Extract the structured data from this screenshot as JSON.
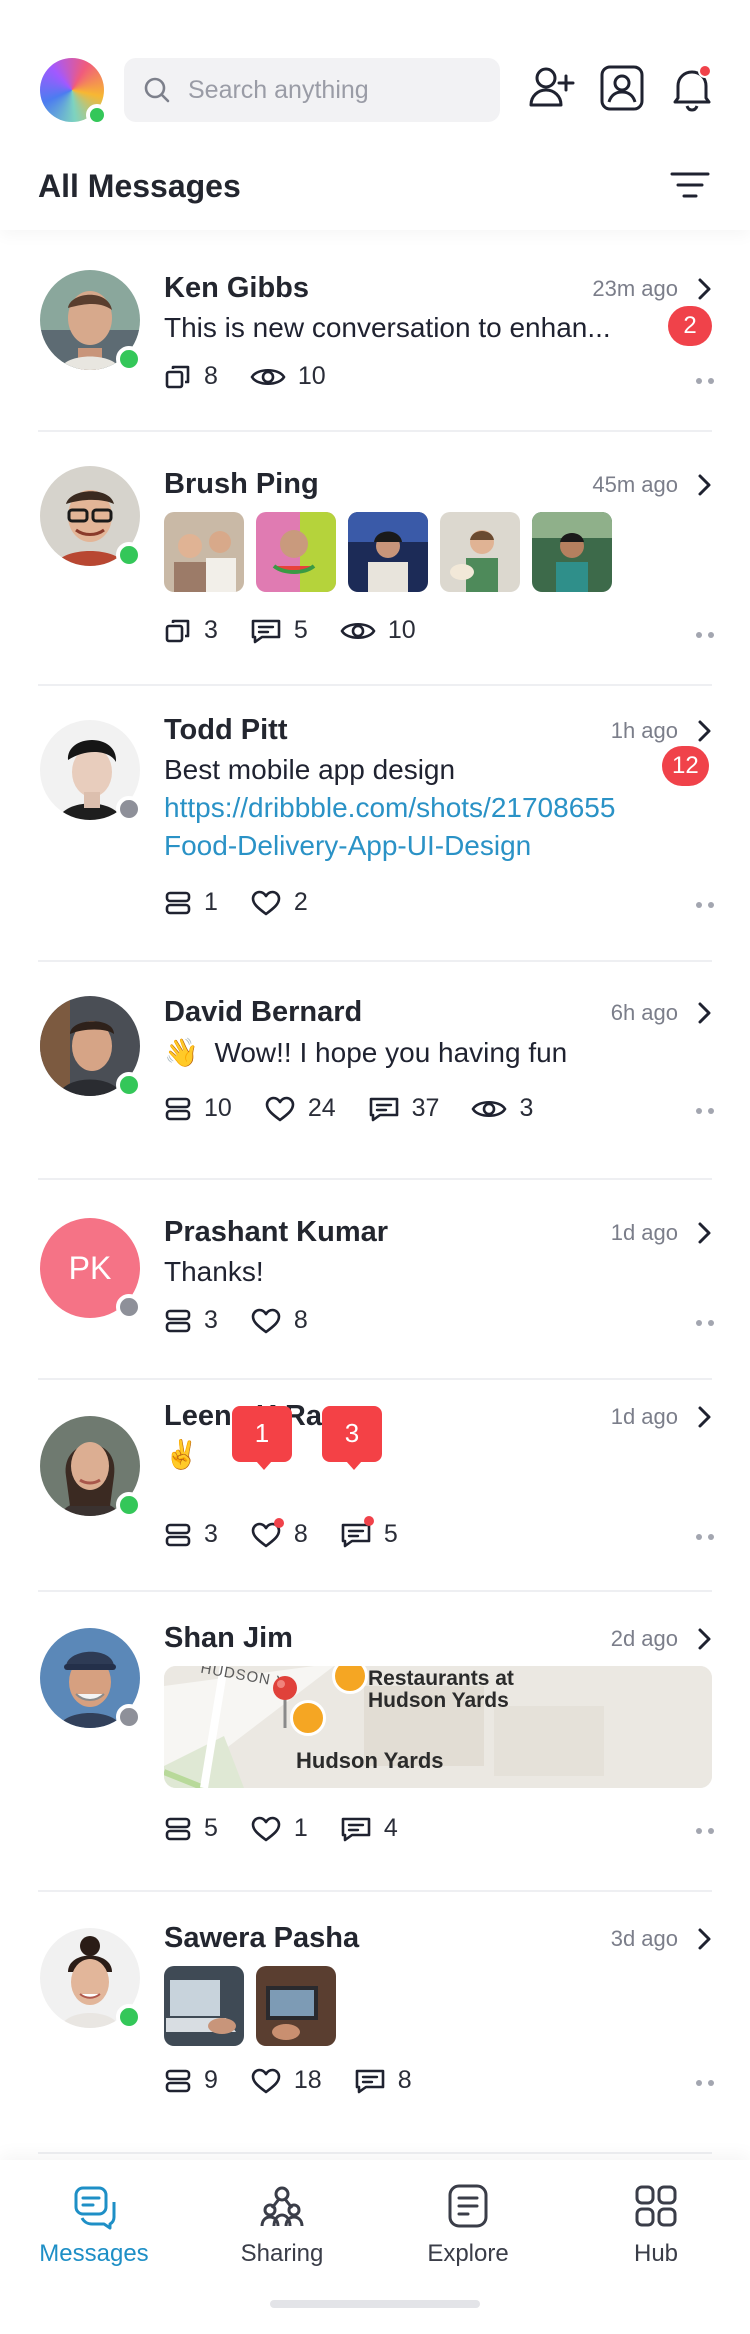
{
  "header": {
    "search_placeholder": "Search anything",
    "title": "All Messages"
  },
  "messages": [
    {
      "name": "Ken Gibbs",
      "time": "23m ago",
      "text": "This is new conversation to enhan...",
      "badge": "2",
      "stats": {
        "copies": "8",
        "views": "10"
      },
      "online": true
    },
    {
      "name": "Brush Ping",
      "time": "45m ago",
      "stats": {
        "copies": "3",
        "comments": "5",
        "views": "10"
      },
      "online": true
    },
    {
      "name": "Todd Pitt",
      "time": "1h ago",
      "text": "Best mobile app design",
      "link_line1": "https://dribbble.com/shots/21708655",
      "link_line2": "Food-Delivery-App-UI-Design",
      "badge": "12",
      "stats": {
        "stacks": "1",
        "likes": "2"
      },
      "online": false
    },
    {
      "name": "David Bernard",
      "time": "6h ago",
      "emoji": "👋",
      "text": "Wow!! I hope you having fun",
      "stats": {
        "stacks": "10",
        "likes": "24",
        "comments": "37",
        "views": "3"
      },
      "online": true
    },
    {
      "name": "Prashant Kumar",
      "initials": "PK",
      "time": "1d ago",
      "text": "Thanks!",
      "stats": {
        "stacks": "3",
        "likes": "8"
      },
      "online": false
    },
    {
      "name": "Leena K Rao",
      "time": "1d ago",
      "emoji": "✌️",
      "tip_likes": "1",
      "tip_comments": "3",
      "stats": {
        "stacks": "3",
        "likes": "8",
        "comments": "5"
      },
      "online": true
    },
    {
      "name": "Shan Jim",
      "time": "2d ago",
      "map": {
        "street": "HUDSON YA",
        "poi_line1": "Restaurants at",
        "poi_line2": "Hudson Yards",
        "place": "Hudson Yards"
      },
      "stats": {
        "stacks": "5",
        "likes": "1",
        "comments": "4"
      },
      "online": false
    },
    {
      "name": "Sawera Pasha",
      "time": "3d ago",
      "stats": {
        "stacks": "9",
        "likes": "18",
        "comments": "8"
      },
      "online": true
    }
  ],
  "tabs": [
    {
      "label": "Messages",
      "active": true
    },
    {
      "label": "Sharing"
    },
    {
      "label": "Explore"
    },
    {
      "label": "Hub"
    }
  ],
  "colors": {
    "accent": "#1e8fc6",
    "online": "#34c759",
    "offline": "#8e9099",
    "badge": "#f0424a",
    "link": "#2a92c6"
  },
  "icons": [
    "search-icon",
    "add-user-icon",
    "profile-icon",
    "bell-icon",
    "filter-icon",
    "copy-icon",
    "eye-icon",
    "comment-icon",
    "heart-icon",
    "stack-icon",
    "chevron-right-icon",
    "more-icon",
    "messages-icon",
    "sharing-icon",
    "explore-icon",
    "hub-icon"
  ]
}
